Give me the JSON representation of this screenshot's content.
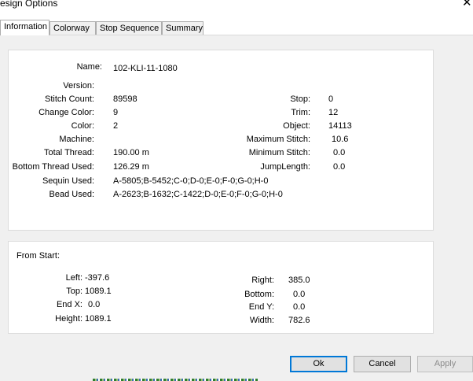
{
  "window": {
    "title": "esign Options",
    "close_glyph": "✕"
  },
  "tabs": [
    {
      "label": "Information",
      "active": true
    },
    {
      "label": "Colorway",
      "active": false
    },
    {
      "label": "Stop Sequence",
      "active": false
    },
    {
      "label": "Summary",
      "active": false
    }
  ],
  "info": {
    "name": {
      "label": "Name:",
      "value": "102-KLI-11-1080"
    },
    "version": {
      "label": "Version:",
      "value": ""
    },
    "stitch_count": {
      "label": "Stitch Count:",
      "value": "89598"
    },
    "change_color": {
      "label": "Change Color:",
      "value": "9"
    },
    "color": {
      "label": "Color:",
      "value": "2"
    },
    "machine": {
      "label": "Machine:",
      "value": ""
    },
    "total_thread": {
      "label": "Total Thread:",
      "value": "190.00 m"
    },
    "bottom_thread": {
      "label": "Bottom Thread Used:",
      "value": "126.29 m"
    },
    "sequin": {
      "label": "Sequin Used:",
      "value": "A-5805;B-5452;C-0;D-0;E-0;F-0;G-0;H-0"
    },
    "bead": {
      "label": "Bead Used:",
      "value": "A-2623;B-1632;C-1422;D-0;E-0;F-0;G-0;H-0"
    },
    "stop": {
      "label": "Stop:",
      "value": "0"
    },
    "trim": {
      "label": "Trim:",
      "value": "12"
    },
    "object": {
      "label": "Object:",
      "value": "14113"
    },
    "max_stitch": {
      "label": "Maximum Stitch:",
      "value": "10.6"
    },
    "min_stitch": {
      "label": "Minimum Stitch:",
      "value": "0.0"
    },
    "jump_length": {
      "label": "JumpLength:",
      "value": "0.0"
    }
  },
  "from_start": {
    "heading": "From Start:",
    "left": {
      "label": "Left:",
      "value": "-397.6"
    },
    "top": {
      "label": "Top:",
      "value": "1089.1"
    },
    "end_x": {
      "label": "End X:",
      "value": "0.0"
    },
    "height": {
      "label": "Height:",
      "value": "1089.1"
    },
    "right": {
      "label": "Right:",
      "value": "385.0"
    },
    "bottom": {
      "label": "Bottom:",
      "value": "0.0"
    },
    "end_y": {
      "label": "End Y:",
      "value": "0.0"
    },
    "width": {
      "label": "Width:",
      "value": "782.6"
    }
  },
  "buttons": {
    "ok": "Ok",
    "cancel": "Cancel",
    "apply": "Apply"
  }
}
